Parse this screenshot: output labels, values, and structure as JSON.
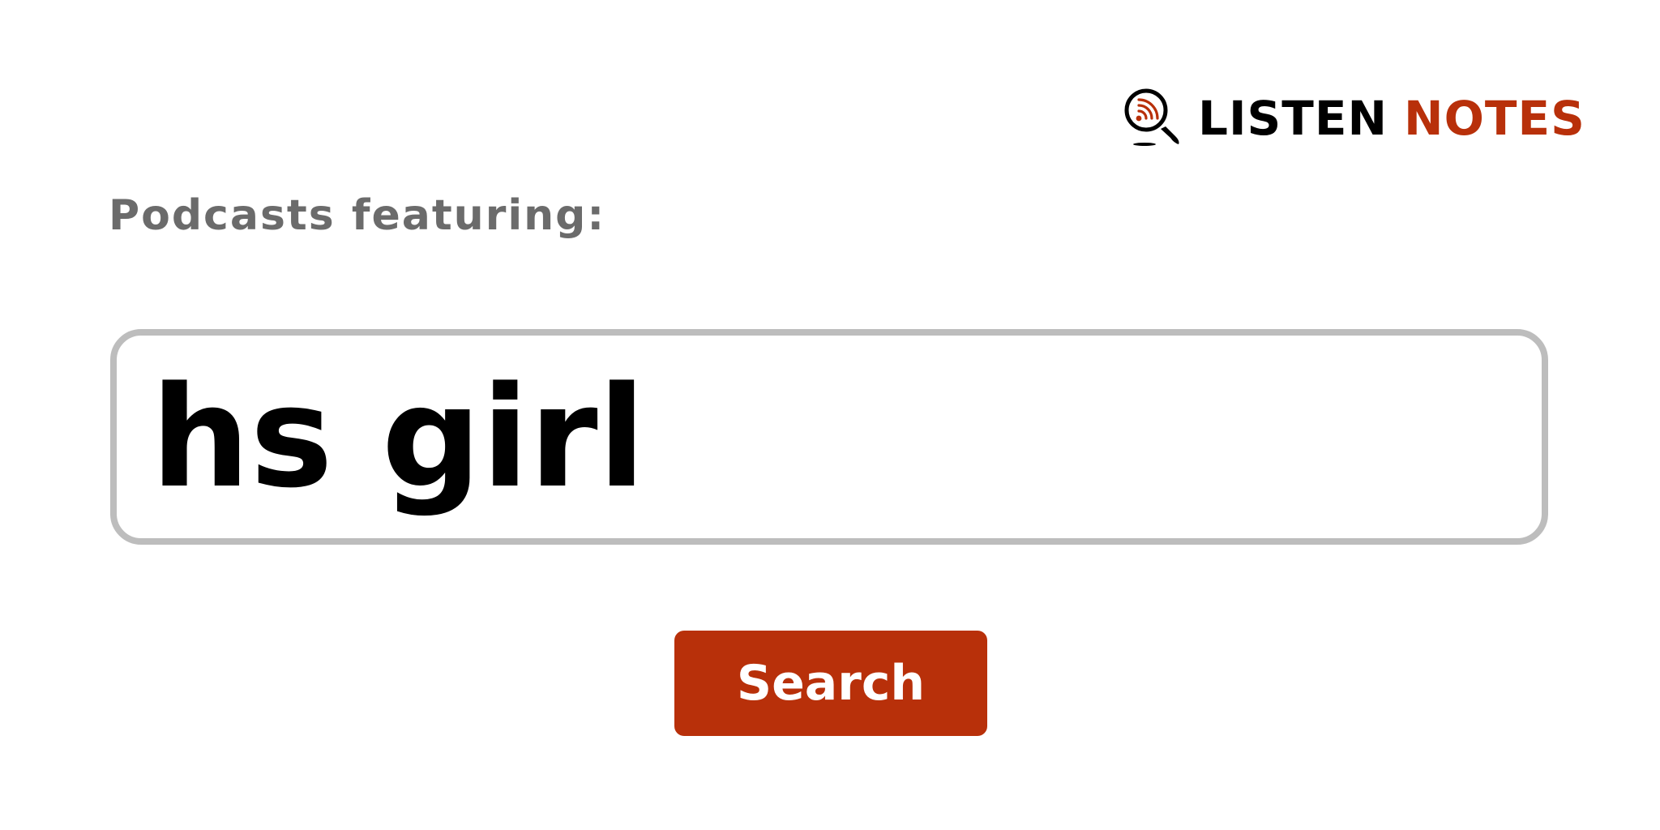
{
  "brand": {
    "word1": "LISTEN",
    "word2": "NOTES",
    "colors": {
      "dark": "#000000",
      "accent": "#b8300a"
    },
    "icon": "magnifier-podcast-icon"
  },
  "featuring_label": "Podcasts featuring:",
  "search": {
    "value": "hs girl",
    "placeholder": ""
  },
  "search_button": {
    "label": "Search",
    "color": "#b8300a"
  },
  "colors": {
    "label_gray": "#6b6b6b",
    "input_border": "#bdbdbd",
    "background": "#ffffff"
  }
}
